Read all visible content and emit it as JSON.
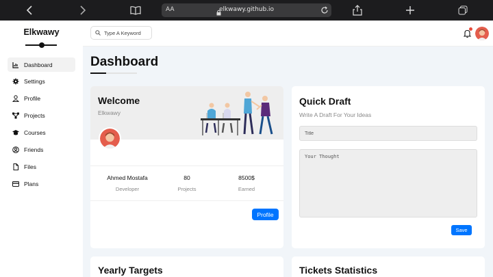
{
  "browser": {
    "aa_label": "AA",
    "url": "elkwawy.github.io"
  },
  "sidebar": {
    "brand": "Elkwawy",
    "items": [
      {
        "label": "Dashboard",
        "icon": "chart-icon",
        "active": true
      },
      {
        "label": "Settings",
        "icon": "gear-icon"
      },
      {
        "label": "Profile",
        "icon": "user-icon"
      },
      {
        "label": "Projects",
        "icon": "diagram-icon"
      },
      {
        "label": "Courses",
        "icon": "graduation-cap-icon"
      },
      {
        "label": "Friends",
        "icon": "user-circle-icon"
      },
      {
        "label": "Files",
        "icon": "file-icon"
      },
      {
        "label": "Plans",
        "icon": "credit-card-icon"
      }
    ]
  },
  "header": {
    "search_placeholder": "Type A Keyword",
    "notification_dot_color": "#e74c3c"
  },
  "page": {
    "title": "Dashboard"
  },
  "welcome": {
    "title": "Welcome",
    "subtitle": "Elkwawy",
    "stats": [
      {
        "value": "Ahmed Mostafa",
        "label": "Developer"
      },
      {
        "value": "80",
        "label": "Projects"
      },
      {
        "value": "8500$",
        "label": "Earned"
      }
    ],
    "profile_button": "Profile"
  },
  "draft": {
    "title": "Quick Draft",
    "subtitle": "Write A Draft For Your Ideas",
    "title_placeholder": "Title",
    "body_placeholder": "Your Thought",
    "save_button": "Save"
  },
  "bottom": {
    "left_title": "Yearly Targets",
    "right_title": "Tickets Statistics"
  },
  "colors": {
    "accent": "#0075ff",
    "page_bg": "#f1f5f9"
  }
}
